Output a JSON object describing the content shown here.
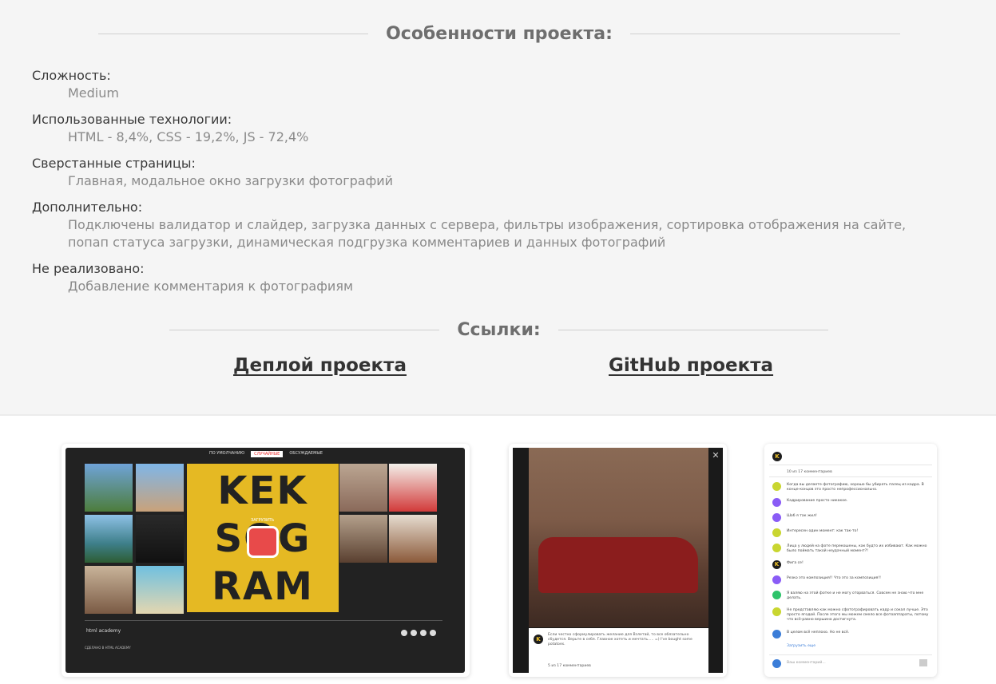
{
  "features_title": "Особенности проекта:",
  "features": [
    {
      "label": "Сложность:",
      "value": "Medium"
    },
    {
      "label": "Использованные технологии:",
      "value": "HTML - 8,4%, CSS - 19,2%, JS - 72,4%"
    },
    {
      "label": "Сверстанные страницы:",
      "value": "Главная, модальное окно загрузки фотографий"
    },
    {
      "label": "Дополнительно:",
      "value": "Подключены валидатор и слайдер, загрузка данных с сервера, фильтры изображения, сортировка отображения на сайте, попап статуса загрузки, динамическая подгрузка комментариев и данных фотографий"
    },
    {
      "label": "Не реализовано:",
      "value": "Добавление комментария к фотографиям"
    }
  ],
  "links_title": "Ссылки:",
  "links": {
    "deploy": "Деплой проекта",
    "github": "GitHub проекта"
  },
  "screens": {
    "main": {
      "filters": [
        "ПО УМОЛЧАНИЮ",
        "СЛУЧАЙНЫЕ",
        "ОБСУЖДАЕМЫЕ"
      ],
      "logo_lines": [
        "KEK",
        "SOG",
        "RAM"
      ],
      "upload_label": "ЗАГРУЗИТЬ",
      "footer_logo": "html academy",
      "footer_made": "СДЕЛАНО В HTML ACADEMY"
    },
    "modal": {
      "comment": "Если честно сформулировать желание для Взлетай, то все обязательно сбудется. Верьте в себя. Главное хотеть и мечтать..... =) I've bought some potatoes.",
      "count": "5 из 17 комментариев"
    },
    "comments": {
      "count": "10 из 17 комментариев",
      "items": [
        {
          "text": "Когда вы делаете фотографию, хорошо бы убирать палец из кадра. В конце-концов это просто непрофессионально.",
          "color": "#c9d630"
        },
        {
          "text": "Кадрирование просто никакое.",
          "color": "#8a5cf6"
        },
        {
          "text": "Шоб я так жил!",
          "color": "#8a5cf6"
        },
        {
          "text": "Интересен один момент: как так-то!",
          "color": "#c9d630"
        },
        {
          "text": "Лица у людей на фоте перекошены, как будто их избивают. Как можно было поймать такой неудачный момент?!",
          "color": "#c9d630"
        },
        {
          "text": "Фига се!",
          "color": "#1e1e1e"
        },
        {
          "text": "Резко это композиция!! Что это за композиция!!",
          "color": "#8a5cf6"
        },
        {
          "text": "Я валяю на этой фотке и не могу оторваться. Совсем не знаю что мне делать.",
          "color": "#2ec36a"
        },
        {
          "text": "Не представляю как можно сфотографировать кадр и сокал лучше. Это просто ягодой. После этого мы можем смело все фотоаппараты, потому что всё-равно вершина достигнута.",
          "color": "#c9d630"
        },
        {
          "text": "В целом всё неплохо. Но не всё.",
          "color": "#3b7dd8"
        }
      ],
      "more": "Загрузить еще",
      "input_placeholder": "Ваш комментарий..."
    }
  }
}
